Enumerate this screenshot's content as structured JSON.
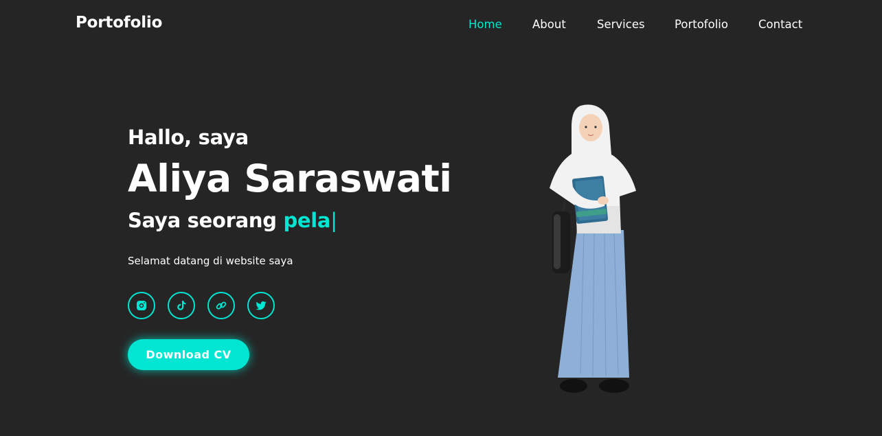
{
  "header": {
    "logo": "Portofolio",
    "nav": [
      {
        "label": "Home",
        "active": true
      },
      {
        "label": "About",
        "active": false
      },
      {
        "label": "Services",
        "active": false
      },
      {
        "label": "Portofolio",
        "active": false
      },
      {
        "label": "Contact",
        "active": false
      }
    ]
  },
  "hero": {
    "greeting": "Hallo, saya",
    "name": "Aliya Saraswati",
    "role_prefix": "Saya seorang ",
    "role_typed": "pela",
    "cursor": "|",
    "description": "Selamat datang di website saya",
    "socials": [
      {
        "icon": "instagram-icon"
      },
      {
        "icon": "tiktok-icon"
      },
      {
        "icon": "link-icon"
      },
      {
        "icon": "twitter-icon"
      }
    ],
    "cta_label": "Download CV"
  },
  "colors": {
    "background": "#252525",
    "accent": "#00e6d2",
    "text": "#ffffff"
  }
}
